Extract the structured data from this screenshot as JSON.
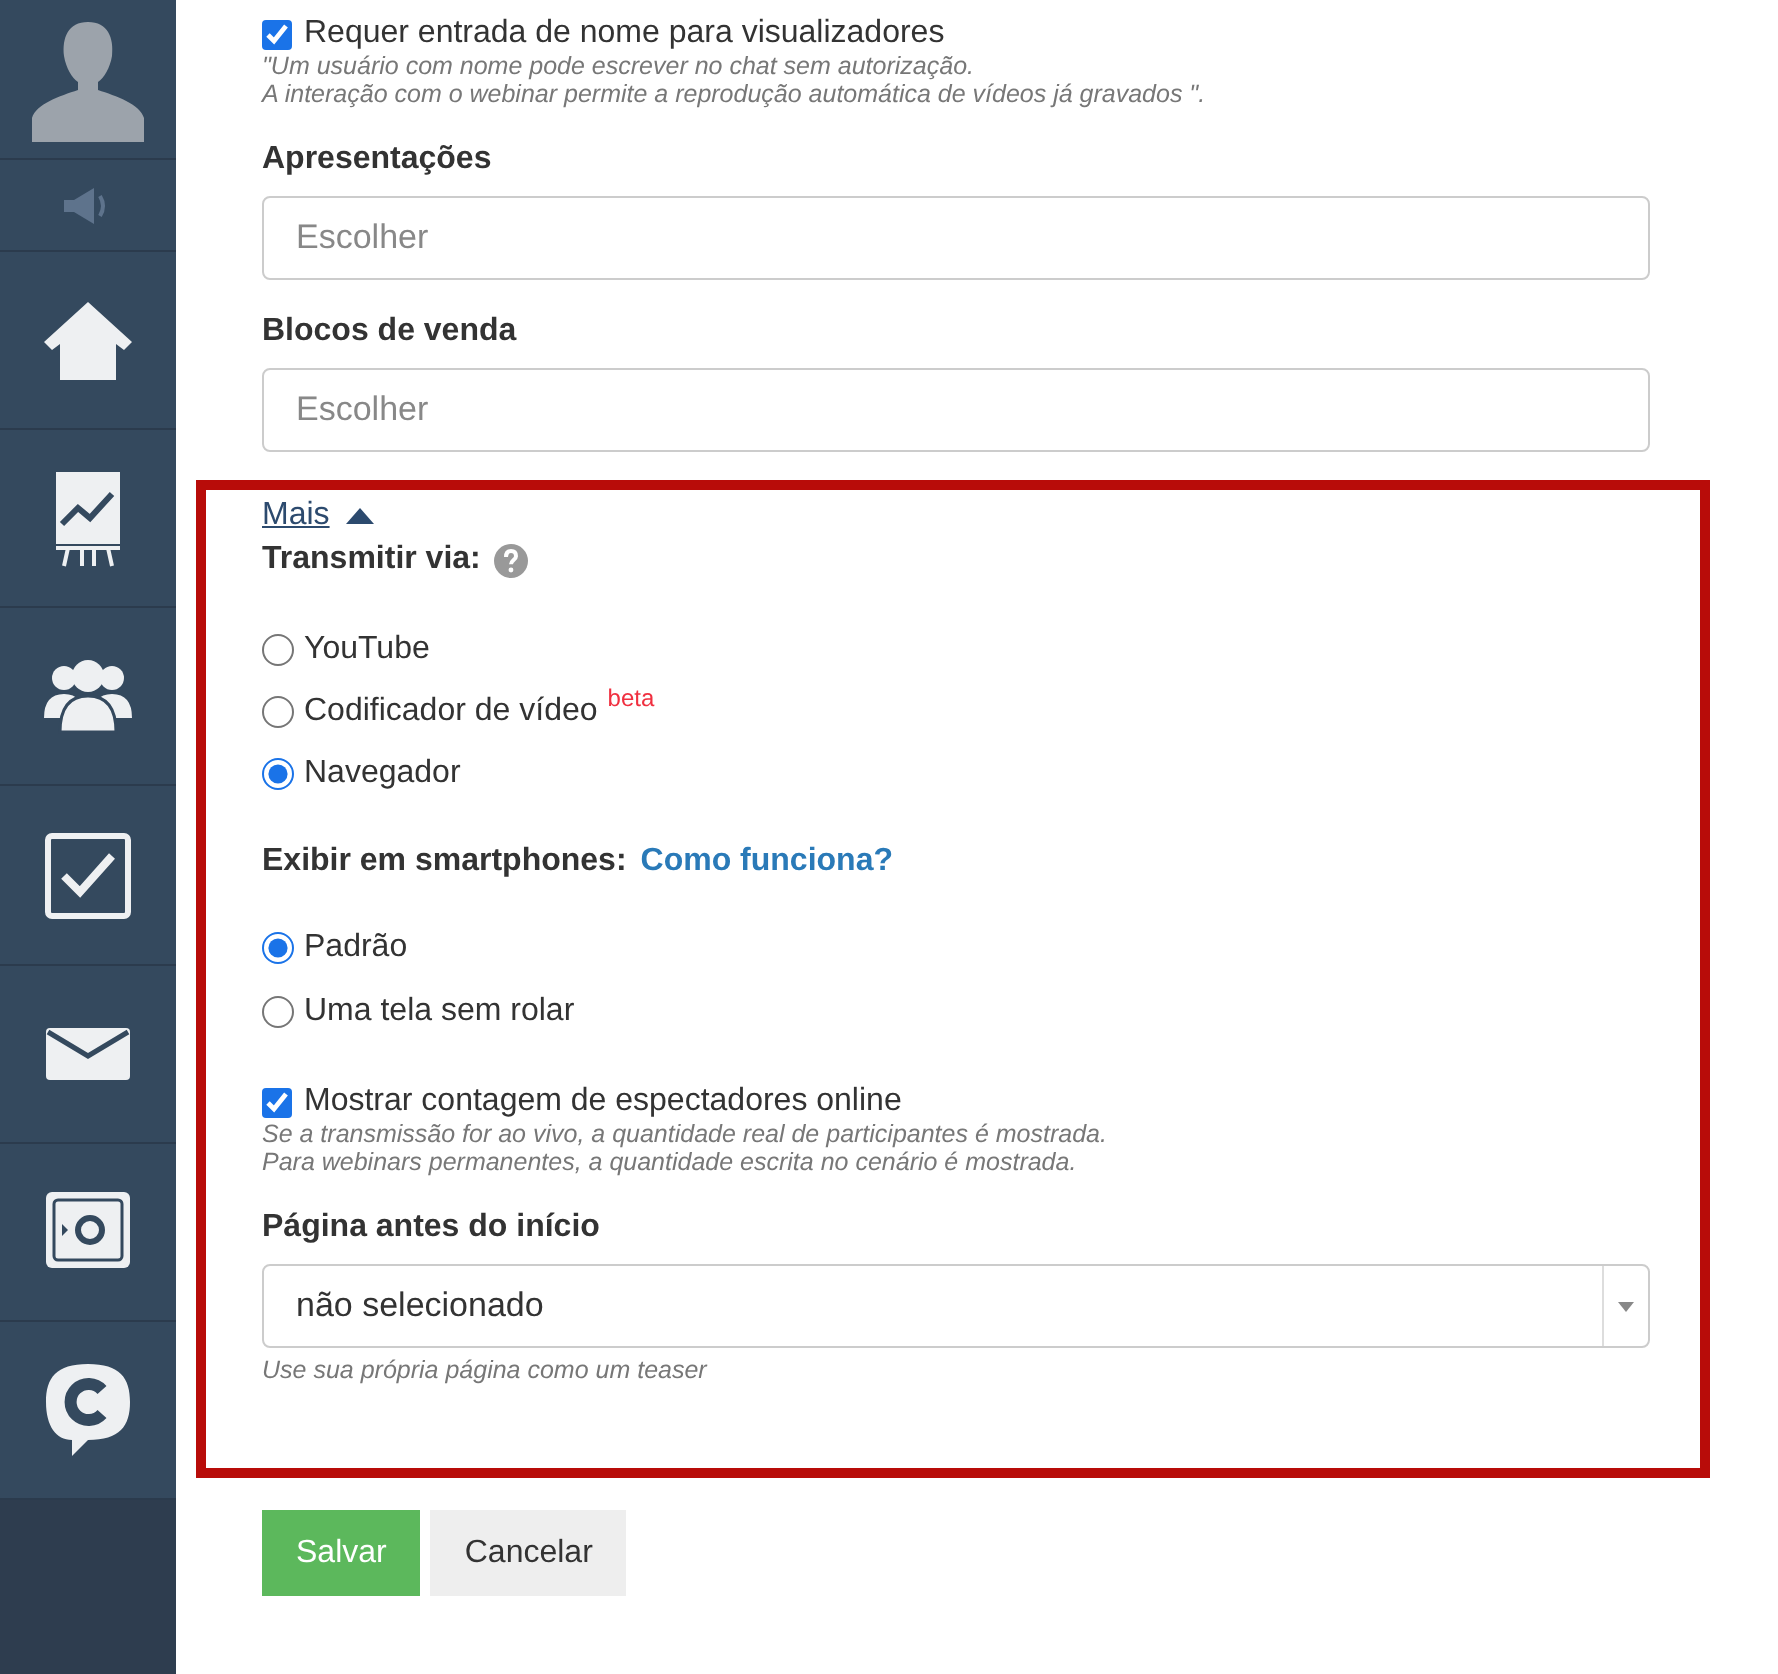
{
  "sidebar": {
    "items": [
      {
        "kind": "avatar"
      },
      {
        "kind": "speaker"
      },
      {
        "kind": "home"
      },
      {
        "kind": "chart"
      },
      {
        "kind": "people"
      },
      {
        "kind": "check"
      },
      {
        "kind": "mail"
      },
      {
        "kind": "safe"
      },
      {
        "kind": "chat"
      }
    ]
  },
  "require_name": {
    "label": "Requer entrada de nome para visualizadores",
    "checked": true,
    "hint": [
      "\"Um usuário com nome pode escrever no chat sem autorização.",
      "A interação com o webinar permite a reprodução automática de vídeos já gravados \"."
    ]
  },
  "presentations": {
    "label": "Apresentações",
    "placeholder": "Escolher"
  },
  "sales_blocks": {
    "label": "Blocos de venda",
    "placeholder": "Escolher"
  },
  "more": {
    "link": "Mais",
    "expanded": true
  },
  "transmit": {
    "label": "Transmitir via:",
    "options": [
      {
        "label": "YouTube",
        "selected": false
      },
      {
        "label": "Codificador de vídeo",
        "badge": "beta",
        "selected": false
      },
      {
        "label": "Navegador",
        "selected": true
      }
    ]
  },
  "smartphones": {
    "label": "Exibir em smartphones:",
    "link": "Como funciona?",
    "options": [
      {
        "label": "Padrão",
        "selected": true
      },
      {
        "label": "Uma tela sem rolar",
        "selected": false
      }
    ]
  },
  "viewer_count": {
    "label": "Mostrar contagem de espectadores online",
    "checked": true,
    "hint": [
      "Se a transmissão for ao vivo, a quantidade real de participantes é mostrada.",
      "Para webinars permanentes, a quantidade escrita no cenário é mostrada."
    ]
  },
  "pre_start_page": {
    "label": "Página antes do início",
    "value": "não selecionado",
    "hint": "Use sua própria página como um teaser"
  },
  "buttons": [
    {
      "label": "Salvar",
      "kind": "primary"
    },
    {
      "label": "Cancelar",
      "kind": "secondary"
    }
  ]
}
